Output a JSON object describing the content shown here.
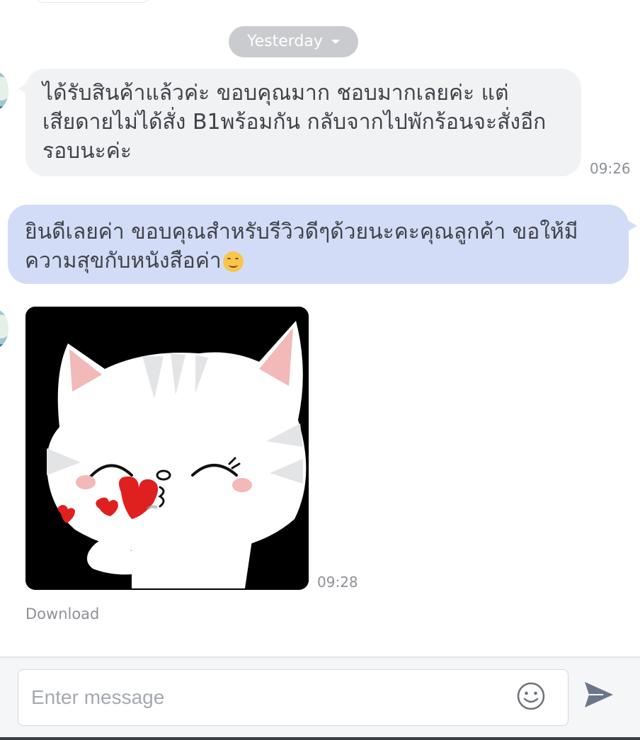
{
  "date_separator": {
    "label": "Yesterday"
  },
  "messages": [
    {
      "direction": "incoming",
      "lines": [
        "ได้รับสินค้าแล้วค่ะ ขอบคุณมาก ชอบมากเลยค่ะ แต่",
        "เสียดายไม่ได้สั่ง B1พร้อมกัน กลับจากไปพักร้อนจะสั่งอีก",
        "รอบนะค่ะ"
      ],
      "time": "09:26"
    },
    {
      "direction": "outgoing",
      "lines": [
        "ยินดีเลยค่า ขอบคุณสำหรับรีวิวดีๆด้วยนะคะคุณลูกค้า ขอให้มี",
        "ความสุขกับหนังสือค่า"
      ],
      "trailing_emoji": "smiling-face"
    },
    {
      "direction": "incoming",
      "type": "sticker",
      "sticker": "white-cat-blowing-hearts",
      "time": "09:28",
      "download_label": "Download"
    }
  ],
  "composer": {
    "placeholder": "Enter message",
    "value": "",
    "emoji_icon": "smiley-face-icon",
    "send_icon": "send-arrow-icon"
  },
  "colors": {
    "incoming_bubble": "#f1f2f4",
    "outgoing_bubble": "#d3dcf7",
    "date_pill": "#c9cbcf",
    "timestamp": "#8d9197"
  }
}
